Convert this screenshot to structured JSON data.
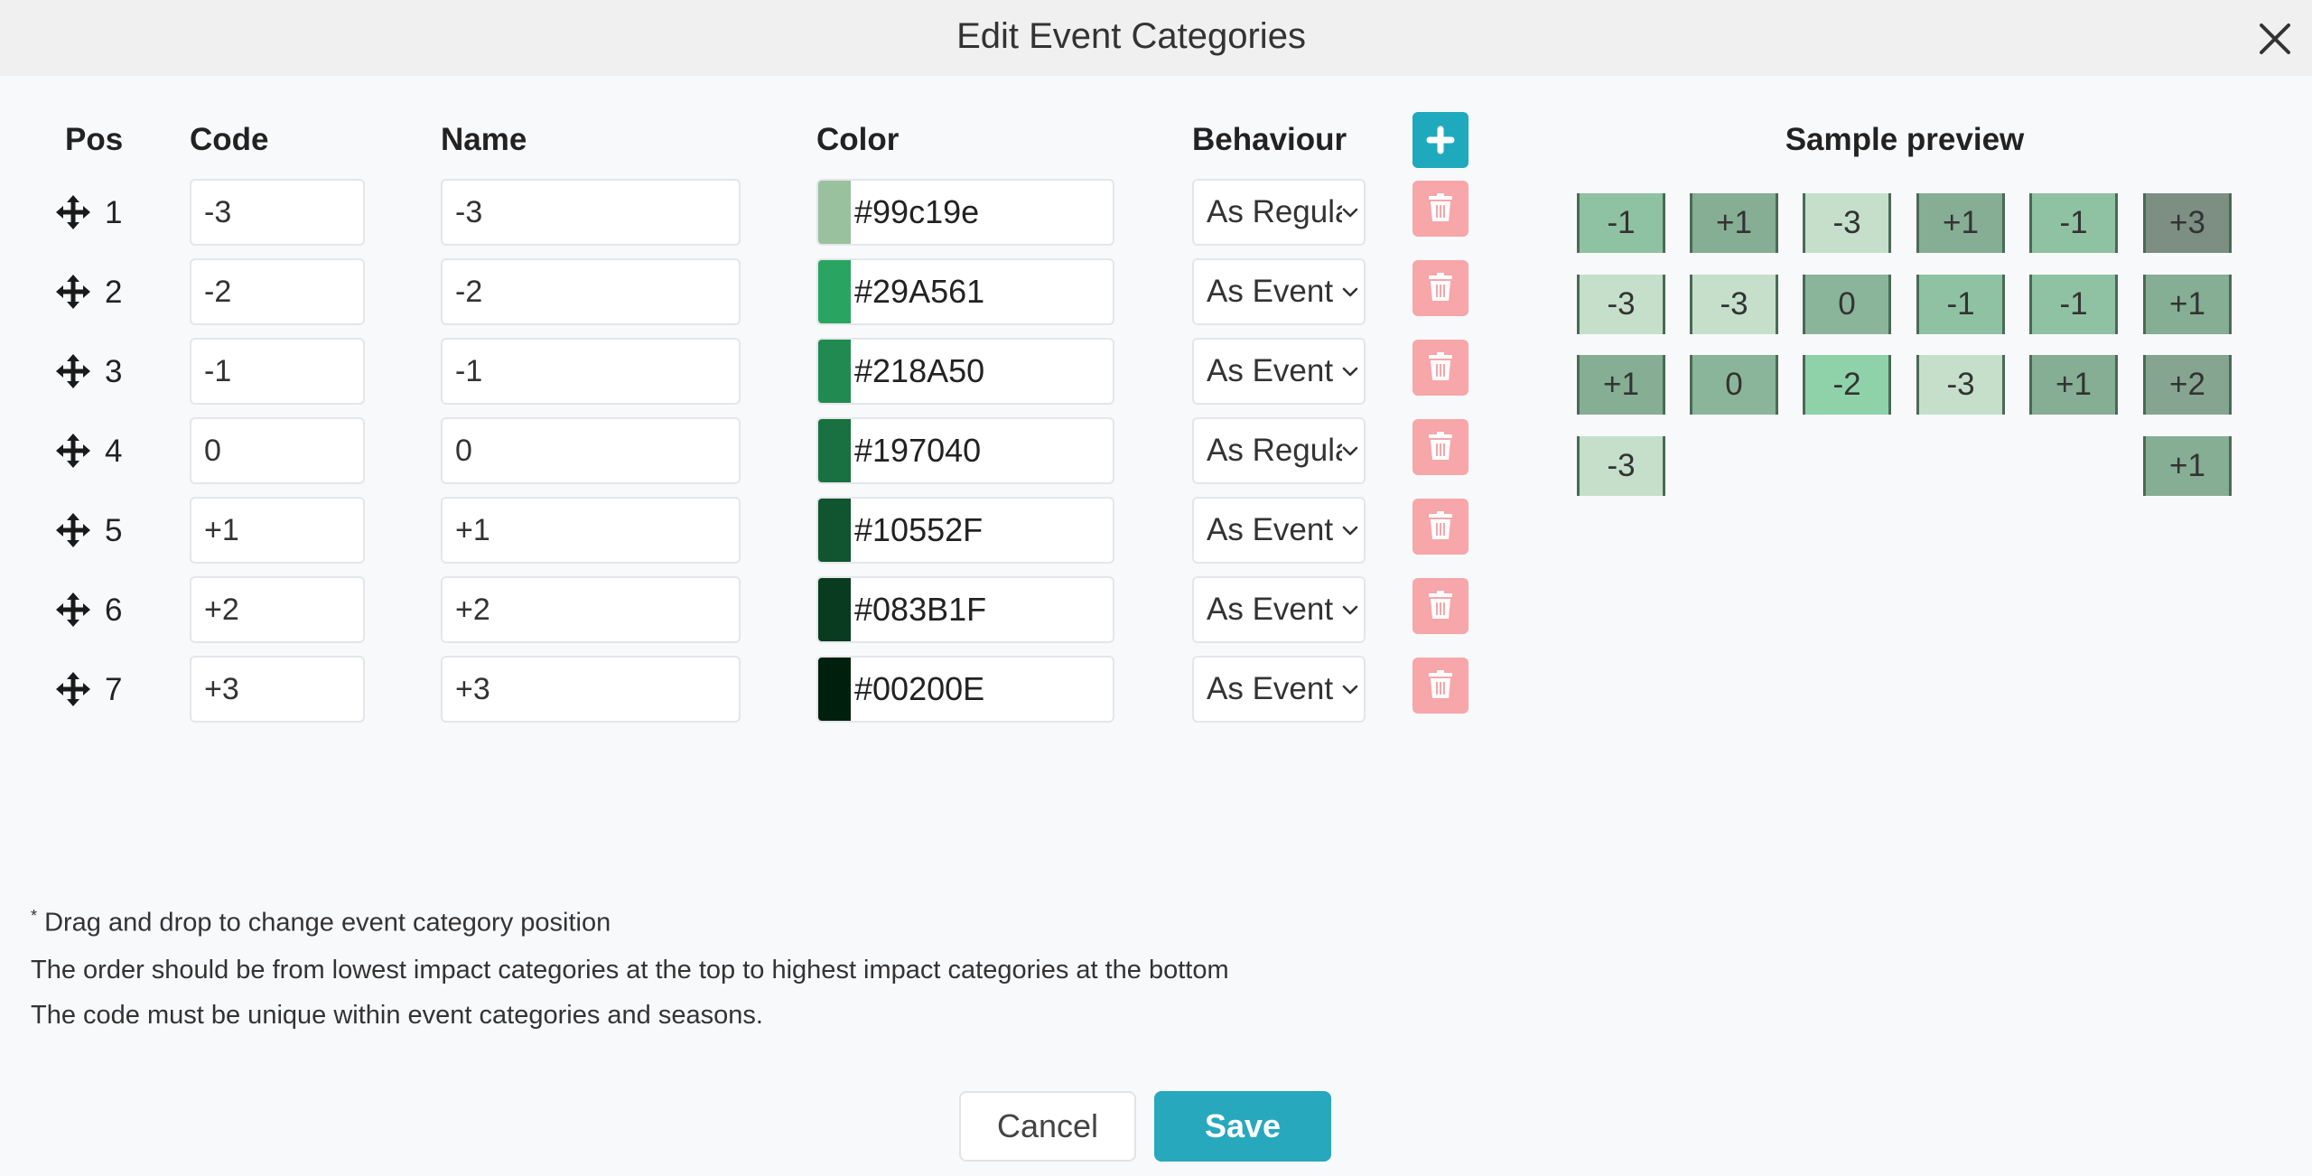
{
  "dialog": {
    "title": "Edit Event Categories"
  },
  "headers": {
    "pos": "Pos",
    "code": "Code",
    "name": "Name",
    "color": "Color",
    "behaviour": "Behaviour"
  },
  "rows": [
    {
      "pos": "1",
      "code": "-3",
      "name": "-3",
      "color": "#99c19e",
      "swatch": "#99c19e",
      "behaviour": "As Regular"
    },
    {
      "pos": "2",
      "code": "-2",
      "name": "-2",
      "color": "#29A561",
      "swatch": "#29A561",
      "behaviour": "As Event"
    },
    {
      "pos": "3",
      "code": "-1",
      "name": "-1",
      "color": "#218A50",
      "swatch": "#218A50",
      "behaviour": "As Event"
    },
    {
      "pos": "4",
      "code": "0",
      "name": "0",
      "color": "#197040",
      "swatch": "#197040",
      "behaviour": "As Regular"
    },
    {
      "pos": "5",
      "code": "+1",
      "name": "+1",
      "color": "#10552F",
      "swatch": "#10552F",
      "behaviour": "As Event"
    },
    {
      "pos": "6",
      "code": "+2",
      "name": "+2",
      "color": "#083B1F",
      "swatch": "#083B1F",
      "behaviour": "As Event"
    },
    {
      "pos": "7",
      "code": "+3",
      "name": "+3",
      "color": "#00200E",
      "swatch": "#00200E",
      "behaviour": "As Event"
    }
  ],
  "preview": {
    "title": "Sample preview",
    "tiles": [
      {
        "label": "-1",
        "bg": "#8fc2a2"
      },
      {
        "label": "+1",
        "bg": "#85ae94"
      },
      {
        "label": "-3",
        "bg": "#c5dfcb"
      },
      {
        "label": "+1",
        "bg": "#85ae94"
      },
      {
        "label": "-1",
        "bg": "#8fc2a2"
      },
      {
        "label": "+3",
        "bg": "#7d8f83"
      },
      {
        "label": "-3",
        "bg": "#c5dfcb"
      },
      {
        "label": "-3",
        "bg": "#c5dfcb"
      },
      {
        "label": "0",
        "bg": "#8bb59a"
      },
      {
        "label": "-1",
        "bg": "#8fc2a2"
      },
      {
        "label": "-1",
        "bg": "#8fc2a2"
      },
      {
        "label": "+1",
        "bg": "#85ae94"
      },
      {
        "label": "+1",
        "bg": "#85ae94"
      },
      {
        "label": "0",
        "bg": "#8bb59a"
      },
      {
        "label": "-2",
        "bg": "#8fd2aa"
      },
      {
        "label": "-3",
        "bg": "#c5dfcb"
      },
      {
        "label": "+1",
        "bg": "#85ae94"
      },
      {
        "label": "+2",
        "bg": "#85a591"
      },
      {
        "label": "-3",
        "bg": "#c5dfcb"
      },
      {
        "label": "+1",
        "bg": "#85ae94"
      }
    ]
  },
  "notes": {
    "marker": "*",
    "line1": "Drag and drop to change event category position",
    "line2": "The order should be from lowest impact categories at the top to highest impact categories at the bottom",
    "line3": "The code must be unique within event categories and seasons."
  },
  "buttons": {
    "cancel": "Cancel",
    "save": "Save"
  },
  "icons": {
    "close": "close-icon",
    "drag": "move-arrows-icon",
    "delete": "trash-icon",
    "add": "plus-icon",
    "dropdown": "chevron-down-icon"
  },
  "colors": {
    "accent": "#27a8bd",
    "delete": "#f7a6a9"
  }
}
